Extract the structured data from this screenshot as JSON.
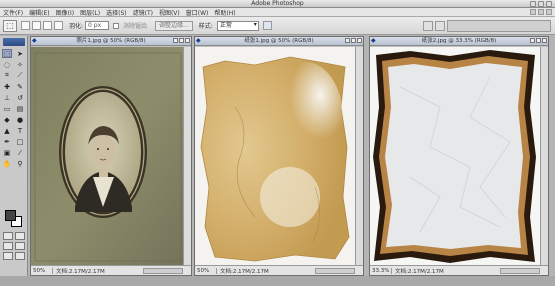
{
  "app": {
    "title": "Adobe Photoshop"
  },
  "menu": {
    "items": [
      "文件(F)",
      "编辑(E)",
      "图像(I)",
      "图层(L)",
      "选择(S)",
      "滤镜(T)",
      "视图(V)",
      "窗口(W)",
      "帮助(H)"
    ]
  },
  "options": {
    "feather_label": "羽化:",
    "feather_value": "0 px",
    "antialias_label": "消除锯齿",
    "refine_button": "调整边缘...",
    "style_label": "样式:",
    "style_value": "正常"
  },
  "documents": [
    {
      "title": "照片1.jpg @ 50% (RGB/8)",
      "zoom": "50%",
      "info": "文档:2.17M/2.17M"
    },
    {
      "title": "纸张1.jpg @ 50% (RGB/8)",
      "zoom": "50%",
      "info": "文档:2.17M/2.17M"
    },
    {
      "title": "纸张2.jpg @ 33.3% (RGB/8)",
      "zoom": "33.3%",
      "info": "文档:2.17M/2.17M"
    }
  ],
  "colors": {
    "foreground": "#444444",
    "background": "#ffffff",
    "titlebar": "#c9c9c9"
  }
}
